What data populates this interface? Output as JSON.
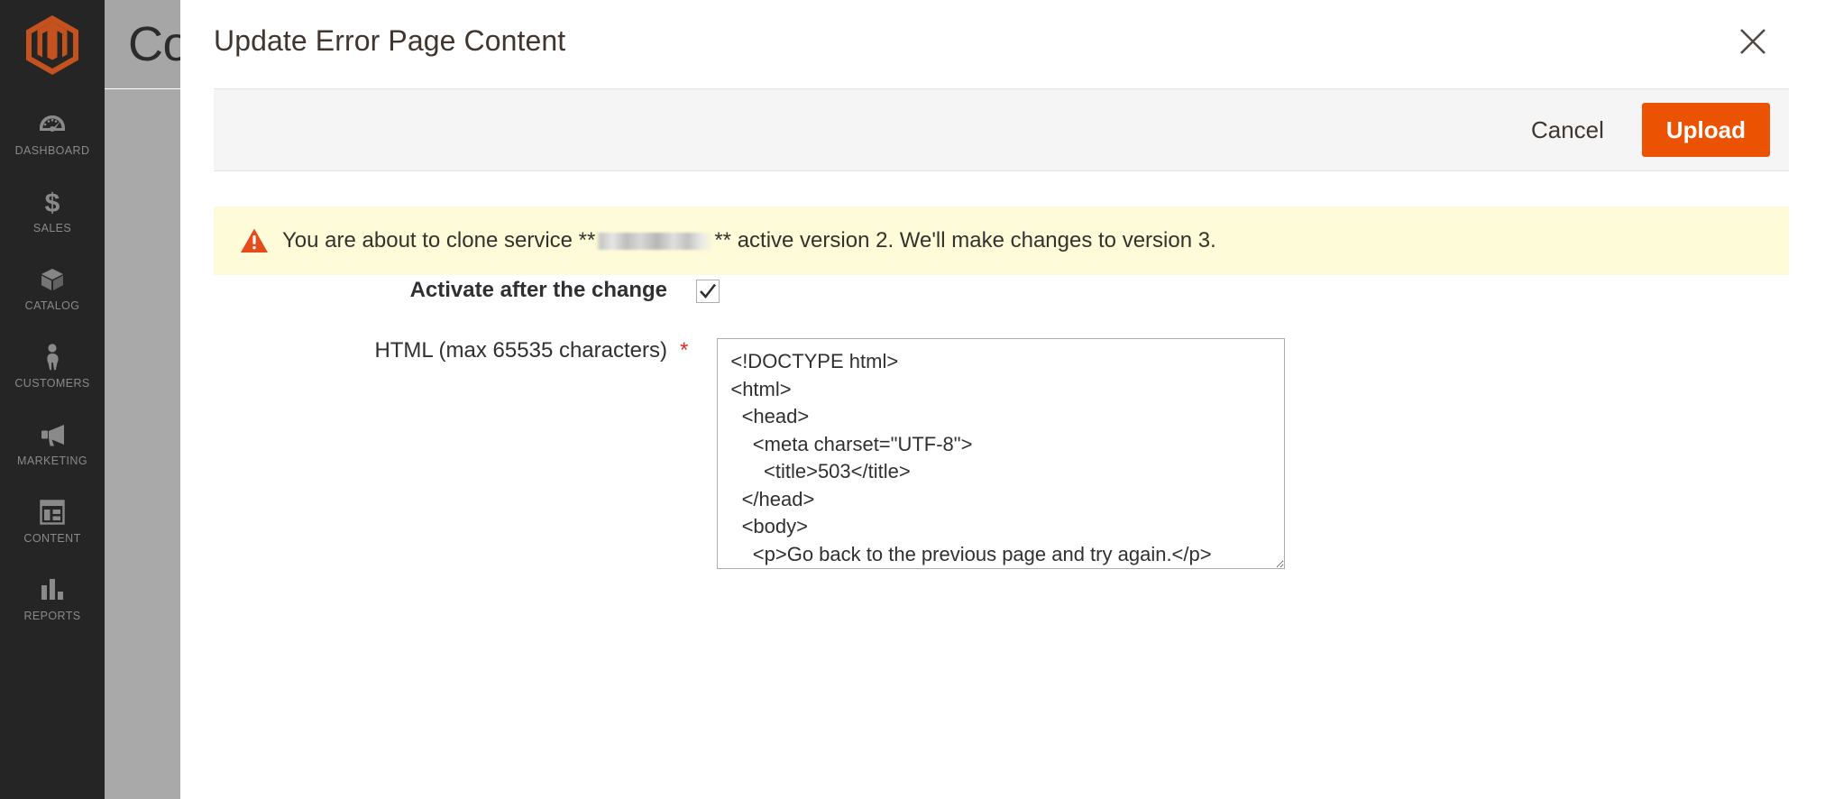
{
  "sidebar": {
    "logo": "magento-logo",
    "items": [
      {
        "label": "DASHBOARD",
        "icon": "dashboard-icon"
      },
      {
        "label": "SALES",
        "icon": "dollar-icon"
      },
      {
        "label": "CATALOG",
        "icon": "box-icon"
      },
      {
        "label": "CUSTOMERS",
        "icon": "person-icon"
      },
      {
        "label": "MARKETING",
        "icon": "megaphone-icon"
      },
      {
        "label": "CONTENT",
        "icon": "layout-icon"
      },
      {
        "label": "REPORTS",
        "icon": "bar-chart-icon"
      }
    ]
  },
  "page": {
    "title_partial": "Con"
  },
  "modal": {
    "title": "Update Error Page Content",
    "close_label": "✕",
    "toolbar": {
      "cancel_label": "Cancel",
      "upload_label": "Upload"
    },
    "banner": {
      "icon": "warning-triangle-icon",
      "text_before": "You are about to clone service **",
      "redacted": "",
      "text_after": "** active version 2. We'll make changes to version 3.",
      "background_color": "#fefbd8",
      "icon_color": "#e64b1e"
    },
    "fields": {
      "activate": {
        "label": "Activate after the change",
        "checked": true,
        "check_glyph": "✓"
      },
      "html": {
        "label": "HTML (max 65535 characters)",
        "required_marker": "*",
        "value": "<!DOCTYPE html>\n<html>\n  <head>\n    <meta charset=\"UTF-8\">\n      <title>503</title>\n  </head>\n  <body>\n    <p>Go back to the previous page and try again.</p>\n    <p><button onclick='history.back();'>Go Back</button></p>\n    <p>If you think something is wrong, <link\nhref=\"https://developer.company.com/guides/1.0.0/\">read it</link> troubleshoot."
      }
    }
  },
  "colors": {
    "accent": "#eb5202",
    "sidebar_bg": "#252525",
    "warning_bg": "#fefbd8",
    "required": "#e02b27"
  }
}
